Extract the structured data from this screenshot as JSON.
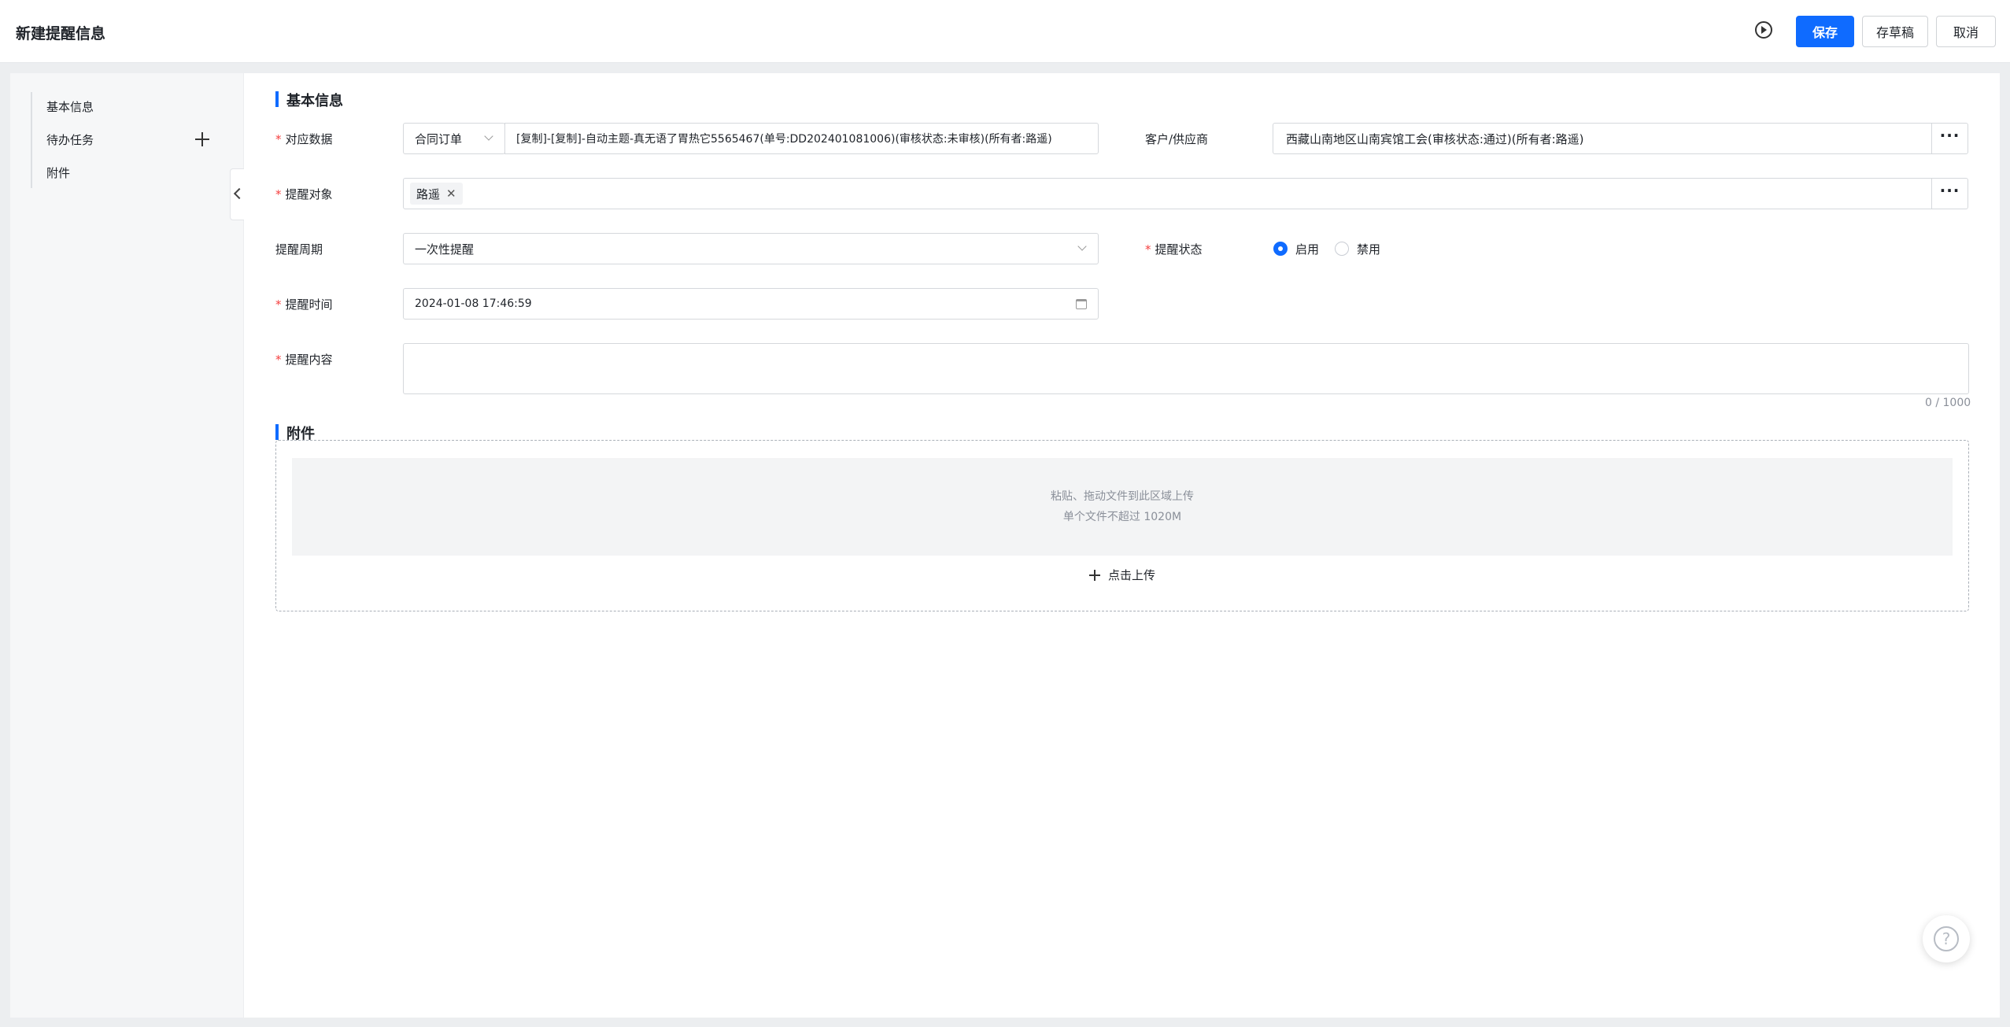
{
  "header": {
    "title": "新建提醒信息",
    "save_label": "保存",
    "draft_label": "存草稿",
    "cancel_label": "取消"
  },
  "sidebar": {
    "items": [
      {
        "label": "基本信息"
      },
      {
        "label": "待办任务"
      },
      {
        "label": "附件"
      }
    ]
  },
  "basic": {
    "section_title": "基本信息",
    "data_label": "对应数据",
    "data_type": "合同订单",
    "data_value": "[复制]-[复制]-自动主题-真无语了胃热它5565467(单号:DD202401081006)(审核状态:未审核)(所有者:路遥)",
    "customer_label": "客户/供应商",
    "customer_value": "西藏山南地区山南宾馆工会(审核状态:通过)(所有者:路遥)",
    "target_label": "提醒对象",
    "target_tag": "路遥",
    "cycle_label": "提醒周期",
    "cycle_value": "一次性提醒",
    "status_label": "提醒状态",
    "status_on": "启用",
    "status_off": "禁用",
    "status_selected": "启用",
    "time_label": "提醒时间",
    "time_value": "2024-01-08 17:46:59",
    "content_label": "提醒内容",
    "content_value": "",
    "content_counter": "0 / 1000"
  },
  "attachment": {
    "section_title": "附件",
    "hint_line1": "粘贴、拖动文件到此区域上传",
    "hint_line2": "单个文件不超过 1020M",
    "upload_label": "点击上传"
  },
  "help": {
    "icon": "question-icon"
  },
  "colors": {
    "primary": "#0f6bff",
    "required": "#f53f3f"
  }
}
